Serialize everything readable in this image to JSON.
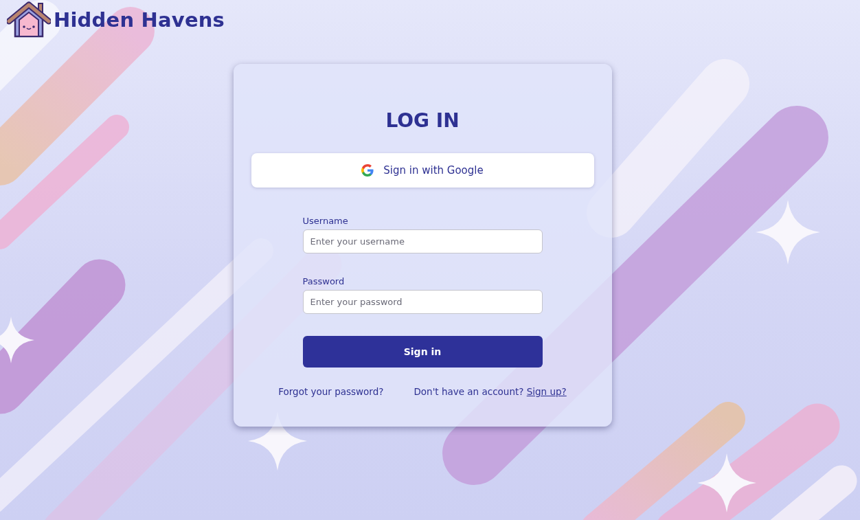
{
  "brand": {
    "name": "Hidden Havens"
  },
  "login": {
    "title": "LOG IN",
    "google_button": "Sign in with Google",
    "fields": [
      {
        "label": "Username",
        "placeholder": "Enter your username"
      },
      {
        "label": "Password",
        "placeholder": "Enter your password"
      }
    ],
    "submit": "Sign in",
    "forgot_link": "Forgot your password?",
    "signup": {
      "prompt": "Don't have an account?",
      "link": "Sign up?"
    }
  }
}
